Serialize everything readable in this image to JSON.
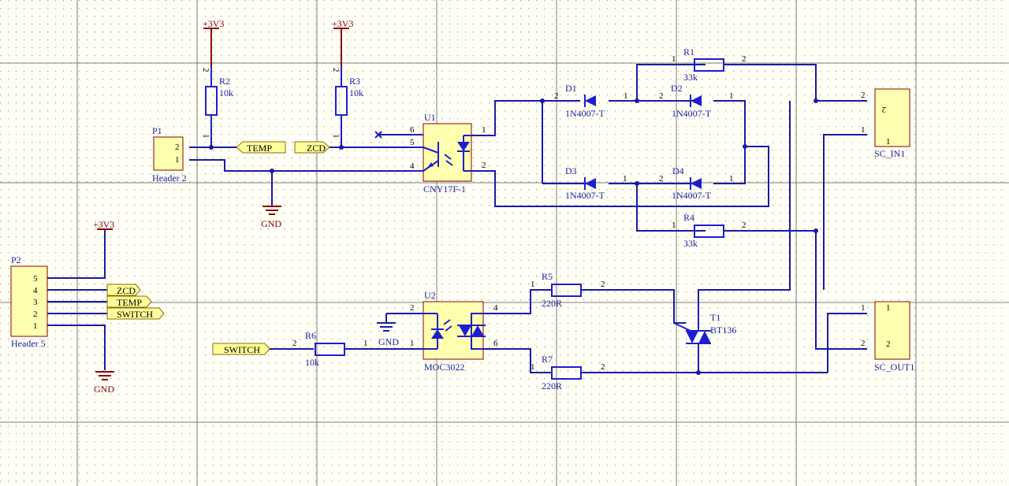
{
  "power": {
    "vcc": "+3V3",
    "gnd": "GND"
  },
  "ports": {
    "temp": "TEMP",
    "zcd": "ZCD",
    "switch": "SWITCH"
  },
  "p1": {
    "ref": "P1",
    "name": "Header 2",
    "pin2": "2",
    "pin1": "1"
  },
  "p2": {
    "ref": "P2",
    "name": "Header 5",
    "pins": [
      "5",
      "4",
      "3",
      "2",
      "1"
    ]
  },
  "r1": {
    "ref": "R1",
    "value": "33k",
    "pa": "1",
    "pb": "2"
  },
  "r2": {
    "ref": "R2",
    "value": "10k",
    "pa": "1",
    "pb": "2"
  },
  "r3": {
    "ref": "R3",
    "value": "10k",
    "pa": "1",
    "pb": "2"
  },
  "r4": {
    "ref": "R4",
    "value": "33k",
    "pa": "1",
    "pb": "2"
  },
  "r5": {
    "ref": "R5",
    "value": "220R",
    "pa": "1",
    "pb": "2"
  },
  "r6": {
    "ref": "R6",
    "value": "10k",
    "pa": "2",
    "pb": "1"
  },
  "r7": {
    "ref": "R7",
    "value": "220R",
    "pa": "1",
    "pb": "2"
  },
  "d1": {
    "ref": "D1",
    "value": "1N4007-T",
    "pa": "2",
    "pb": "1"
  },
  "d2": {
    "ref": "D2",
    "value": "1N4007-T",
    "pa": "2",
    "pb": "1"
  },
  "d3": {
    "ref": "D3",
    "value": "1N4007-T",
    "pa": "2",
    "pb": "1"
  },
  "d4": {
    "ref": "D4",
    "value": "1N4007-T",
    "pa": "2",
    "pb": "1"
  },
  "u1": {
    "ref": "U1",
    "value": "CNY17F-1",
    "pins": [
      "6",
      "5",
      "4",
      "1",
      "2"
    ]
  },
  "u2": {
    "ref": "U2",
    "value": "MOC3022",
    "pins": [
      "2",
      "1",
      "4",
      "6"
    ]
  },
  "t1": {
    "ref": "T1",
    "value": "BT136"
  },
  "sc_in": {
    "ref": "SC_IN1",
    "pin2": "2",
    "pin1": "1",
    "inner2": "2",
    "inner1": "1"
  },
  "sc_out": {
    "ref": "SC_OUT1",
    "pin1": "1",
    "pin2": "2",
    "inner1": "1",
    "inner2": "2"
  },
  "colors": {
    "wire": "#1a1aa8",
    "power": "#8b0000",
    "port_fill": "#ffff99",
    "background": "#fffff5"
  }
}
